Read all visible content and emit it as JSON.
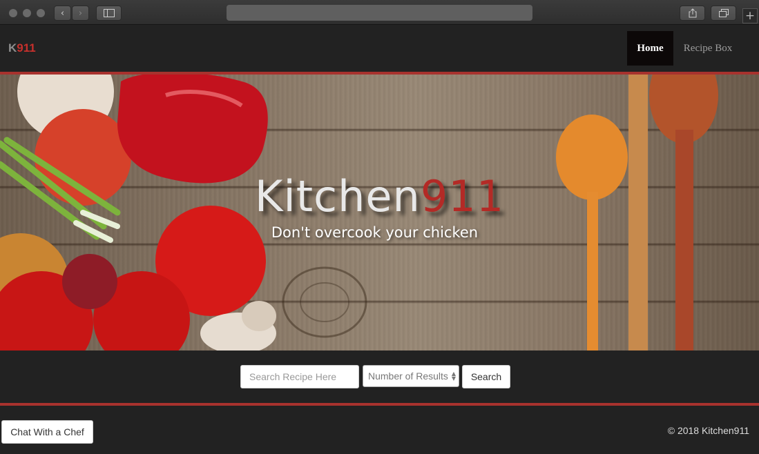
{
  "browser": {
    "new_tab_icon": "plus-icon",
    "back_icon": "chevron-left-icon",
    "forward_icon": "chevron-right-icon",
    "sidebar_icon": "sidebar-icon",
    "share_icon": "share-icon",
    "tabs_icon": "tabs-icon"
  },
  "navbar": {
    "brand_k": "K",
    "brand_num": "911",
    "items": [
      {
        "label": "Home",
        "active": true
      },
      {
        "label": "Recipe Box",
        "active": false
      }
    ],
    "accent_color": "#a8322e"
  },
  "hero": {
    "title_main": "Kitchen",
    "title_accent": "911",
    "subtitle": "Don't overcook your chicken"
  },
  "search": {
    "placeholder": "Search Recipe Here",
    "results_select_label": "Number of Results",
    "button_label": "Search"
  },
  "footer": {
    "chat_button_label": "Chat With a Chef",
    "copyright": "© 2018 Kitchen911"
  }
}
